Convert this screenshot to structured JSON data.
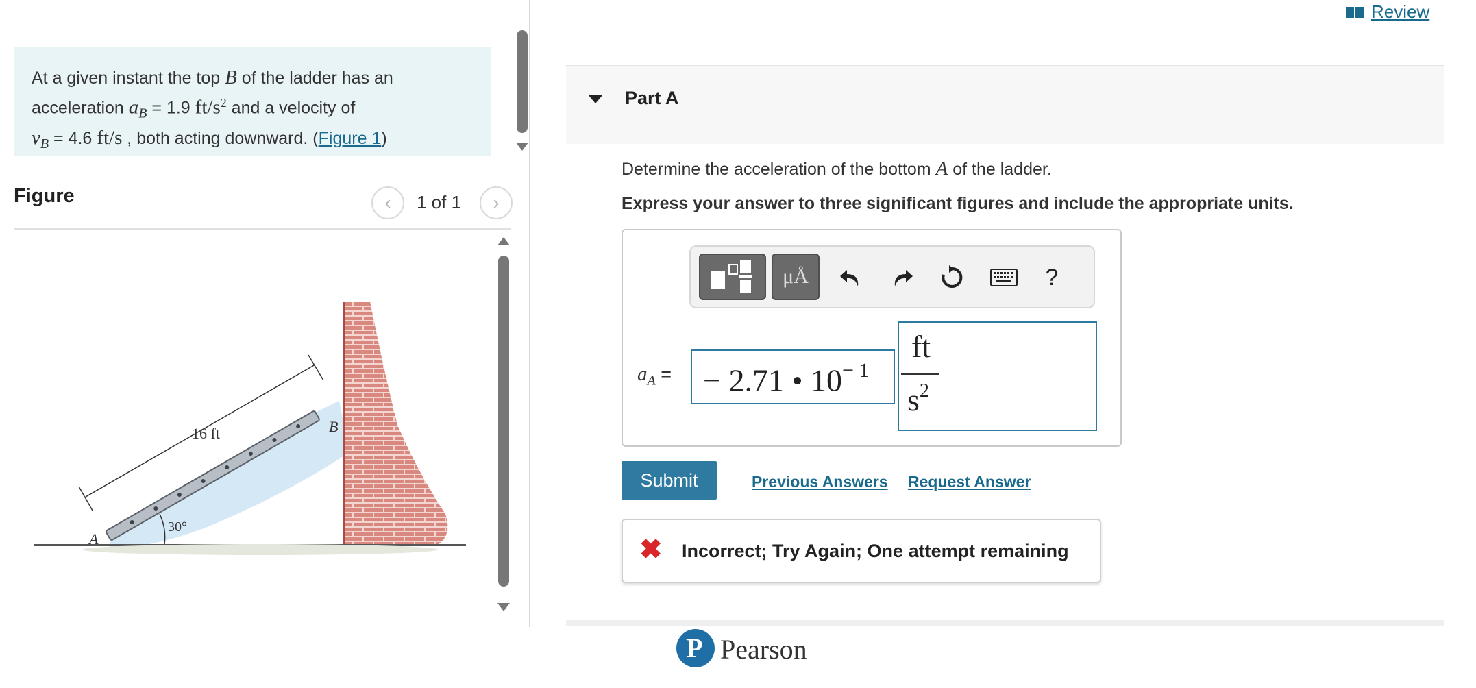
{
  "problem": {
    "text_1": "At a given instant the top ",
    "var_B": "B",
    "text_2": " of the ladder has an",
    "text_3": "acceleration ",
    "var_aB": "a",
    "sub_B": "B",
    "text_4": " = 1.9 ",
    "unit_acc": "ft/s",
    "unit_acc_exp": "2",
    "text_5": " and a velocity of",
    "var_vB": "v",
    "sub_vB": "B",
    "text_6": " = 4.6 ",
    "unit_vel": "ft/s",
    "text_7": " , both acting downward. (",
    "figure_link": "Figure 1",
    "text_8": ")"
  },
  "figure": {
    "title": "Figure",
    "prev_icon": "chevron-left-icon",
    "next_icon": "chevron-right-icon",
    "count": "1 of 1",
    "length_label": "16 ft",
    "angle_label": "30°",
    "point_a": "A",
    "point_b": "B"
  },
  "header": {
    "review_label": "Review",
    "review_icon": "book-icon"
  },
  "part": {
    "toggle_icon": "caret-down-icon",
    "title": "Part A",
    "question_1": "Determine the acceleration of the bottom ",
    "question_var": "A",
    "question_2": " of the ladder.",
    "instruction": "Express your answer to three significant figures and include the appropriate units."
  },
  "toolbar": {
    "templates_icon": "templates-icon",
    "units_label": "μÅ",
    "undo_icon": "undo-icon",
    "redo_icon": "redo-icon",
    "reset_icon": "reset-icon",
    "keyboard_icon": "keyboard-icon",
    "help_label": "?"
  },
  "answer": {
    "label_var": "a",
    "label_sub": "A",
    "label_eq": " =",
    "value_main": "− 2.71 • 10",
    "value_exp": "− 1",
    "unit_num": "ft",
    "unit_den": "s",
    "unit_den_exp": "2"
  },
  "actions": {
    "submit_label": "Submit",
    "previous_answers": "Previous Answers",
    "request_answer": "Request Answer"
  },
  "feedback": {
    "icon": "x-mark-icon",
    "text": "Incorrect; Try Again; One attempt remaining"
  },
  "footer": {
    "brand": "Pearson",
    "logo_letter": "P"
  },
  "colors": {
    "accent": "#2f7aa0",
    "link": "#1a6a8e",
    "error": "#d9262a",
    "problem_bg": "#e9f4f6"
  }
}
